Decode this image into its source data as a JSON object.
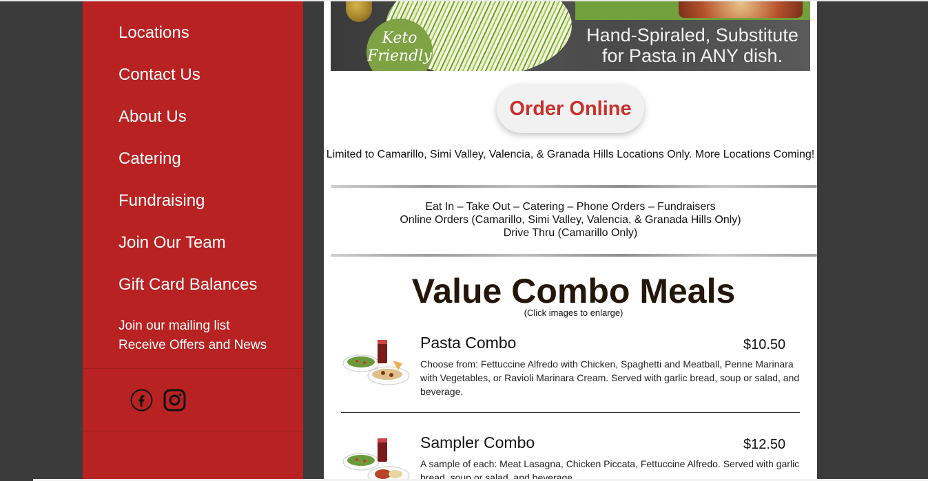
{
  "sidebar": {
    "nav": [
      {
        "label": "Locations"
      },
      {
        "label": "Contact Us"
      },
      {
        "label": "About Us"
      },
      {
        "label": "Catering"
      },
      {
        "label": "Fundraising"
      },
      {
        "label": "Join Our Team"
      },
      {
        "label": "Gift Card Balances"
      }
    ],
    "mailing_line1": "Join our mailing list",
    "mailing_line2": "Receive Offers and News",
    "social_icons": [
      "facebook-icon",
      "instagram-icon"
    ],
    "background": "#b82222"
  },
  "banner": {
    "badge_line1": "Keto",
    "badge_line2": "Friendly",
    "text_line1": "Hand-Spiraled, Substitute",
    "text_line2": "for Pasta in ANY dish."
  },
  "order_online": {
    "label": "Order Online",
    "color": "#c8312b"
  },
  "limited_note": "Limited to Camarillo, Simi Valley, Valencia, & Granada Hills Locations Only. More Locations Coming!",
  "services": {
    "line1": "Eat In – Take Out – Catering – Phone Orders – Fundraisers",
    "line2": "Online Orders (Camarillo, Simi Valley, Valencia, & Granada Hills Only)",
    "line3": "Drive Thru (Camarillo Only)"
  },
  "menu": {
    "title": "Value Combo Meals",
    "subtitle": "(Click images to enlarge)",
    "items": [
      {
        "name": "Pasta Combo",
        "price": "$10.50",
        "description": "Choose from: Fettuccine Alfredo with Chicken, Spaghetti and Meatball, Penne Marinara with Vegetables, or Ravioli Marinara Cream. Served with garlic bread, soup or salad, and beverage."
      },
      {
        "name": "Sampler Combo",
        "price": "$12.50",
        "description": "A sample of each: Meat Lasagna, Chicken Piccata, Fettuccine Alfredo. Served with garlic bread, soup or salad, and beverage."
      }
    ]
  }
}
